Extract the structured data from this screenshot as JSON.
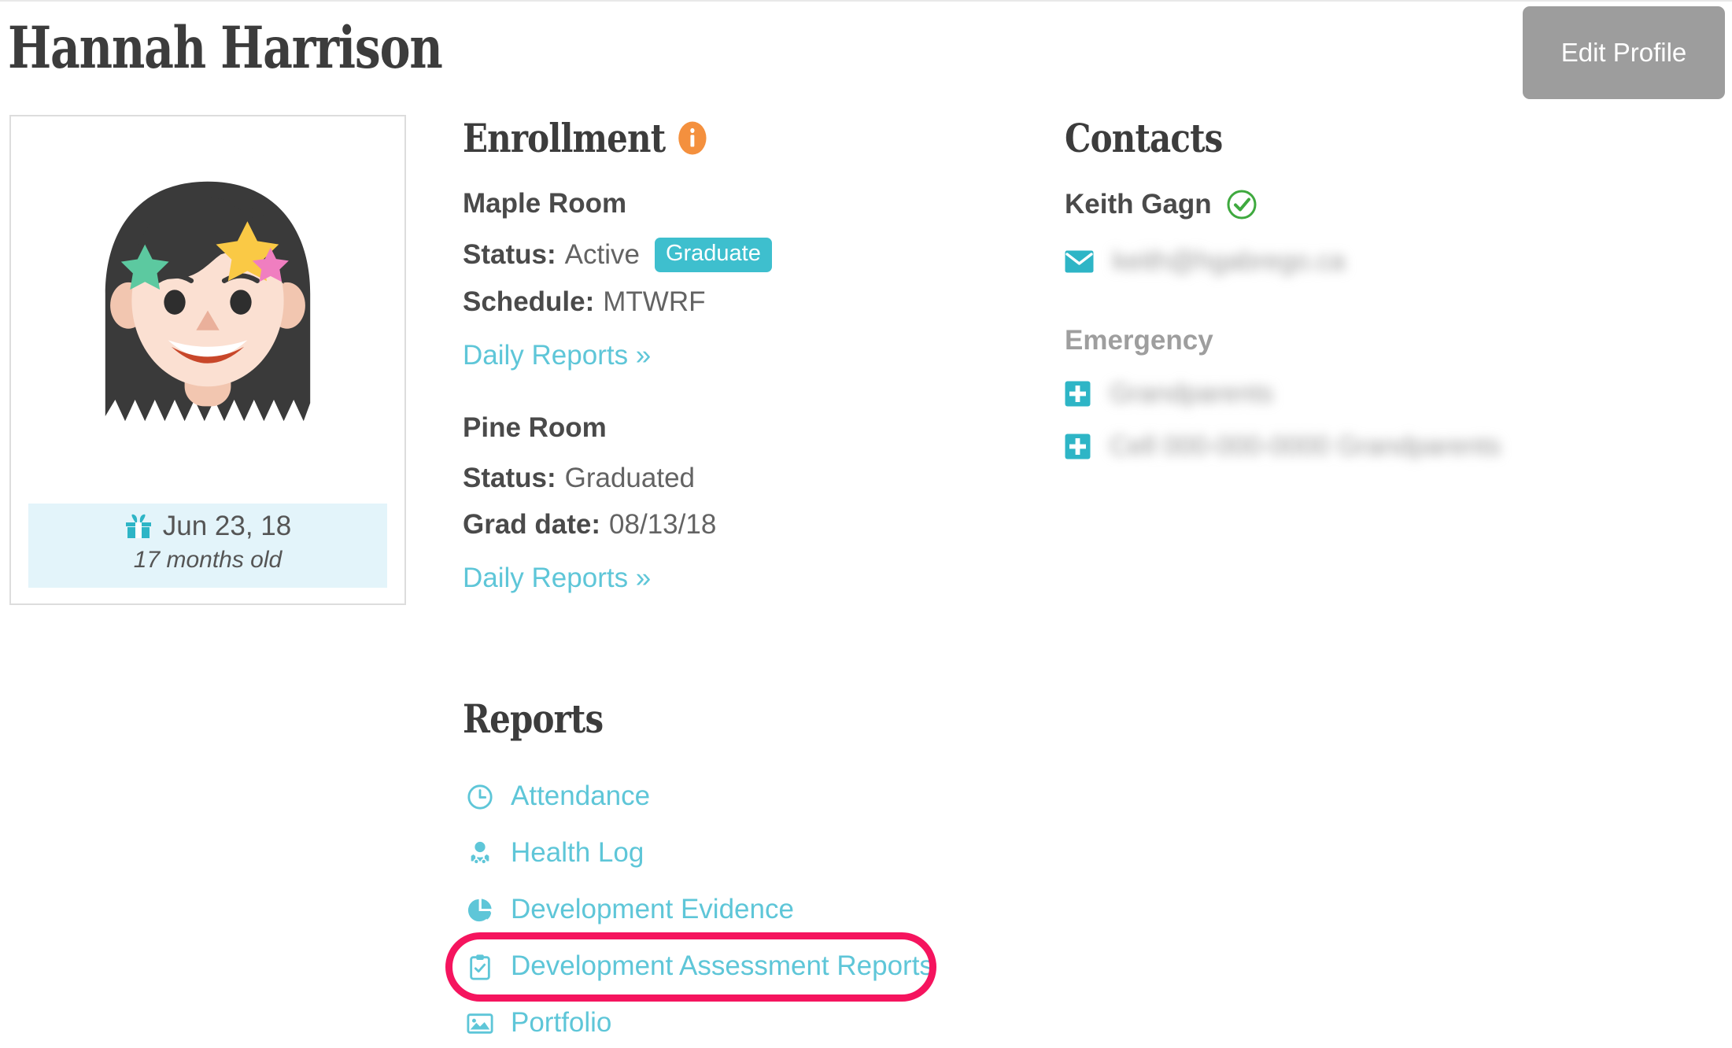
{
  "header": {
    "child_name": "Hannah Harrison",
    "edit_profile_label": "Edit Profile"
  },
  "avatar_card": {
    "avatar_alt": "child-avatar",
    "birthday_icon": "gift-icon",
    "birthday": "Jun 23, 18",
    "age": "17 months old"
  },
  "enrollment": {
    "heading": "Enrollment",
    "info_icon": "info-circle-icon",
    "rooms": [
      {
        "name": "Maple Room",
        "status_label": "Status:",
        "status_value": "Active",
        "badge": "Graduate",
        "detail_label": "Schedule:",
        "detail_value": "MTWRF",
        "link": "Daily Reports »"
      },
      {
        "name": "Pine Room",
        "status_label": "Status:",
        "status_value": "Graduated",
        "badge": null,
        "detail_label": "Grad date:",
        "detail_value": "08/13/18",
        "link": "Daily Reports »"
      }
    ]
  },
  "contacts": {
    "heading": "Contacts",
    "primary": {
      "name": "Keith Gagn",
      "verified_icon": "check-circle-icon",
      "email_icon": "envelope-icon",
      "email_redacted": "keith@hgabrego.ca"
    },
    "emergency": {
      "heading": "Emergency",
      "items": [
        {
          "icon": "plus-square-icon",
          "text_redacted": "Grandparents"
        },
        {
          "icon": "plus-square-icon",
          "text_redacted": "Cell 000-000-0000 Grandparents"
        }
      ]
    }
  },
  "reports": {
    "heading": "Reports",
    "items": [
      {
        "icon": "clock-icon",
        "label": "Attendance",
        "highlighted": false
      },
      {
        "icon": "user-md-icon",
        "label": "Health Log",
        "highlighted": false
      },
      {
        "icon": "pie-chart-icon",
        "label": "Development Evidence",
        "highlighted": false
      },
      {
        "icon": "clipboard-check-icon",
        "label": "Development Assessment Reports",
        "highlighted": true
      },
      {
        "icon": "image-icon",
        "label": "Portfolio",
        "highlighted": false
      }
    ]
  },
  "colors": {
    "teal": "#5ec6d8",
    "teal_solid": "#3ebfce",
    "orange": "#f4903e",
    "green": "#3ea93e",
    "highlight_pink": "#f5145e",
    "button_gray": "#9d9d9d",
    "birthday_bg": "#e3f4fa"
  }
}
